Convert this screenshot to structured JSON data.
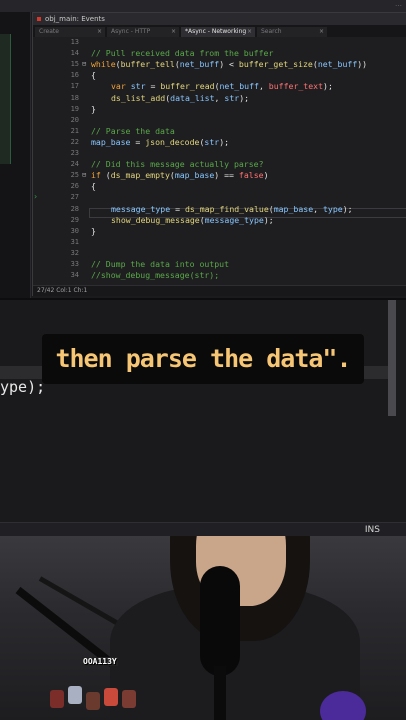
{
  "top_ide": {
    "top_strip_text": "…",
    "window_title": "obj_main: Events",
    "tabs": [
      {
        "label": "Create",
        "active": false
      },
      {
        "label": "Async - HTTP",
        "active": false
      },
      {
        "label": "*Async - Networking",
        "active": true
      },
      {
        "label": "Search",
        "active": false
      }
    ],
    "code_lines": [
      {
        "n": "13",
        "text": ""
      },
      {
        "n": "14",
        "text": "// Pull received data from the buffer"
      },
      {
        "n": "15",
        "text": "while(buffer_tell(net_buff) < buffer_get_size(net_buff))"
      },
      {
        "n": "16",
        "text": "{"
      },
      {
        "n": "17",
        "text": "var str = buffer_read(net_buff, buffer_text);"
      },
      {
        "n": "18",
        "text": "ds_list_add(data_list, str);"
      },
      {
        "n": "19",
        "text": "}"
      },
      {
        "n": "20",
        "text": ""
      },
      {
        "n": "21",
        "text": "// Parse the data"
      },
      {
        "n": "22",
        "text": "map_base = json_decode(str);"
      },
      {
        "n": "23",
        "text": ""
      },
      {
        "n": "24",
        "text": "// Did this message actually parse?"
      },
      {
        "n": "25",
        "text": "if (ds_map_empty(map_base) == false)"
      },
      {
        "n": "26",
        "text": "{"
      },
      {
        "n": "27",
        "text": ""
      },
      {
        "n": "28",
        "text": "message_type = ds_map_find_value(map_base, type);"
      },
      {
        "n": "29",
        "text": "show_debug_message(message_type);"
      },
      {
        "n": "30",
        "text": "}"
      },
      {
        "n": "31",
        "text": ""
      },
      {
        "n": "32",
        "text": ""
      },
      {
        "n": "33",
        "text": "// Dump the data into output"
      },
      {
        "n": "34",
        "text": "//show_debug_message(str);"
      }
    ],
    "status": "27/42 Col:1 Ch:1"
  },
  "mid_ide": {
    "code_fragment": "ype);",
    "mode_label": "INS"
  },
  "caption": {
    "text": "then parse the data\"."
  },
  "webcam": {
    "name_tag": "OOA113Y"
  },
  "colors": {
    "comment": "#5aa84a",
    "keyword": "#f0a33a",
    "function": "#e2d57d",
    "constant": "#ff7272",
    "variable": "#88c6ff",
    "caption_text": "#f7c675"
  }
}
